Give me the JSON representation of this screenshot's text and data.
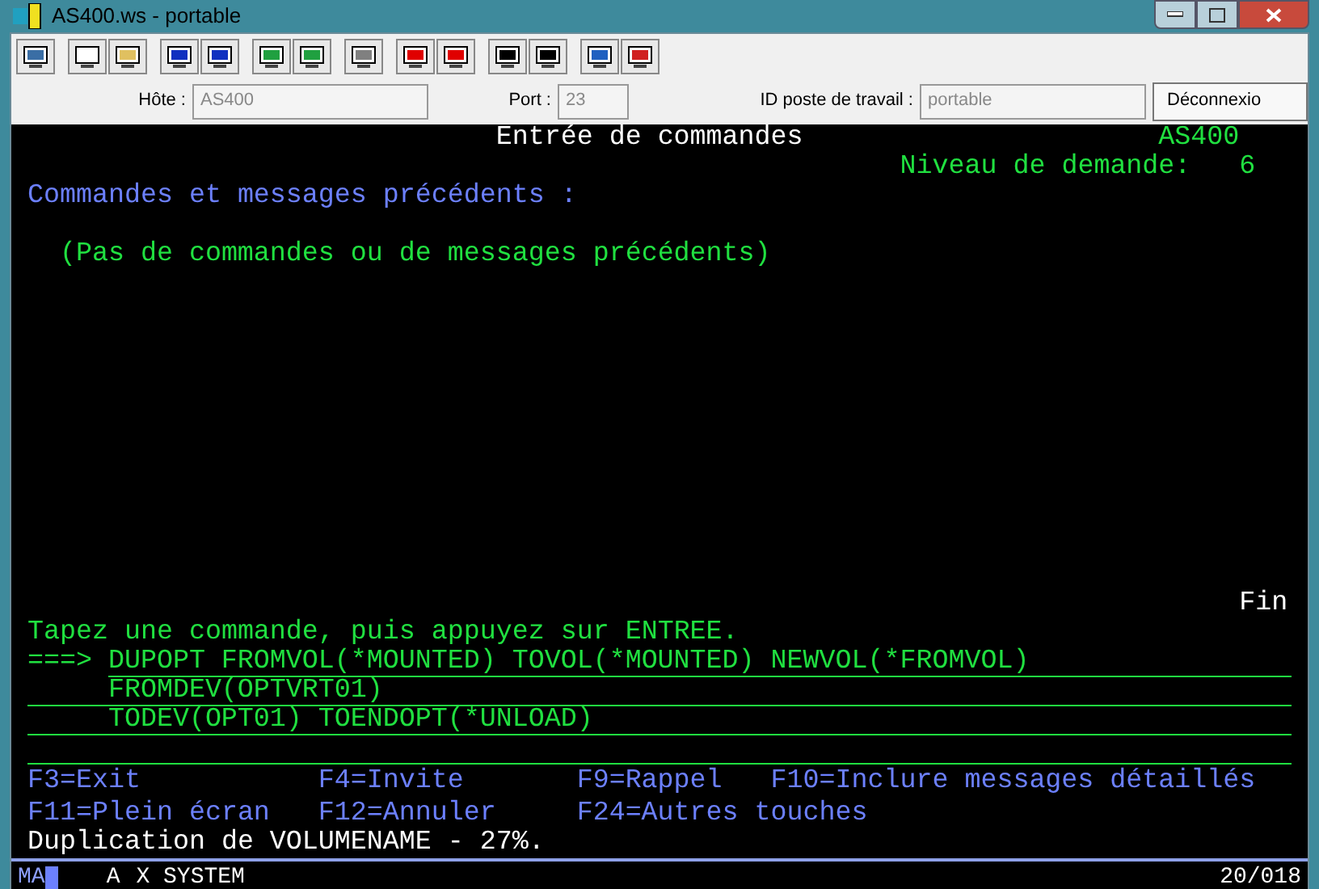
{
  "window": {
    "title": "AS400.ws - portable"
  },
  "connection_bar": {
    "fields": [
      {
        "label": "Hôte :",
        "value": "AS400"
      },
      {
        "label": "Port :",
        "value": "23"
      },
      {
        "label": "ID poste de travail :",
        "value": "portable"
      }
    ],
    "button": "Déconnexio"
  },
  "terminal": {
    "title": "Entrée de commandes",
    "system": "AS400",
    "level_label": "Niveau de demande:",
    "level_value": "6",
    "section_title": "Commandes et messages précédents :",
    "empty_message": "(Pas de commandes ou de messages précédents)",
    "more": "Fin",
    "prompt": "Tapez une commande, puis appuyez sur ENTREE.",
    "arrow": "===>",
    "command_lines": [
      "DUPOPT FROMVOL(*MOUNTED) TOVOL(*MOUNTED) NEWVOL(*FROMVOL)",
      "FROMDEV(OPTVRT01)",
      "TODEV(OPT01) TOENDOPT(*UNLOAD)"
    ],
    "function_keys": [
      [
        "F3=Exit",
        "F4=Invite",
        "F9=Rappel",
        "F10=Inclure messages détaillés"
      ],
      [
        "F11=Plein écran",
        "F12=Annuler",
        "F24=Autres touches"
      ]
    ],
    "message": "Duplication de VOLUMENAME - 27%."
  },
  "status_bar": {
    "mode": "MA",
    "session": "A",
    "system": "X SYSTEM",
    "position": "20/018"
  }
}
